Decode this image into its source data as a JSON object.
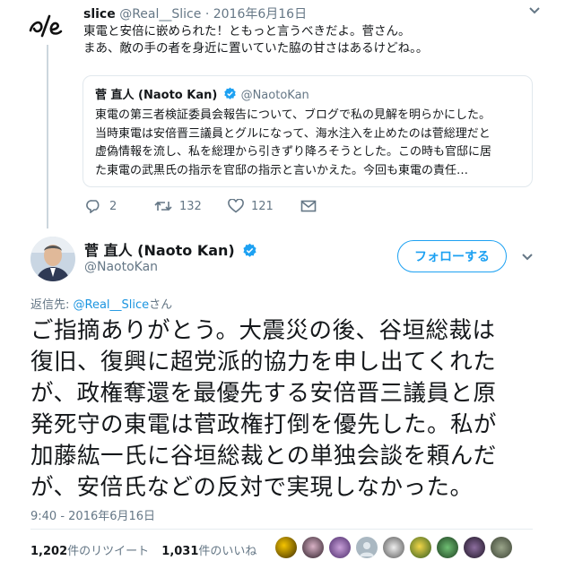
{
  "reply_tweet": {
    "display_name": "slice",
    "handle": "@Real__Slice",
    "separator": "·",
    "date": "2016年6月16日",
    "lines": [
      "東電と安倍に嵌められた！ともっと言うべきだよ。菅さん。",
      "まあ、敵の手の者を身近に置いていた脇の甘さはあるけどね。。"
    ],
    "logo_text": "ぷ/e"
  },
  "quoted_tweet": {
    "display_name": "菅 直人 (Naoto Kan)",
    "handle": "@NaotoKan",
    "lines": [
      "東電の第三者検証委員会報告について、ブログで私の見解を明らかにした。",
      "当時東電は安倍晋三議員とグルになって、海水注入を止めたのは菅総理だと",
      "虚偽情報を流し、私を総理から引きずり降ろそうとした。この時も官邸に居",
      "た東電の武黒氏の指示を官邸の指示と言いかえた。今回も東電の責任…"
    ]
  },
  "reply_actions": {
    "replies": "2",
    "retweets": "132",
    "likes": "121"
  },
  "main_tweet": {
    "display_name": "菅 直人 (Naoto Kan)",
    "handle": "@NaotoKan",
    "follow_label": "フォローする",
    "reply_to_prefix": "返信先: ",
    "reply_to_handle": "@Real__Slice",
    "reply_to_suffix": "さん",
    "text_lines": [
      "ご指摘ありがとう。大震災の後、谷垣総裁は",
      "復旧、復興に超党派的協力を申し出てくれた",
      "が、政権奪還を最優先する安倍晋三議員と原",
      "発死守の東電は菅政権打倒を優先した。私が",
      "加藤紘一氏に谷垣総裁との単独会談を頼んだ",
      "が、安倍氏などの反対で実現しなかった。"
    ],
    "timestamp": "9:40 - 2016年6月16日",
    "retweet_count": "1,202",
    "retweet_label": "件のリツイート",
    "like_count": "1,031",
    "like_label": "件のいいね"
  },
  "colors": {
    "accent": "#1da1f2",
    "link": "#1b95e0",
    "muted": "#657786",
    "verified": "#1da1f2",
    "divider": "#e6ecf0"
  },
  "icons": {
    "reply": "reply-icon",
    "retweet": "retweet-icon",
    "like": "heart-icon",
    "dm": "envelope-icon",
    "caret": "chevron-down-icon",
    "verified": "verified-badge-icon"
  }
}
